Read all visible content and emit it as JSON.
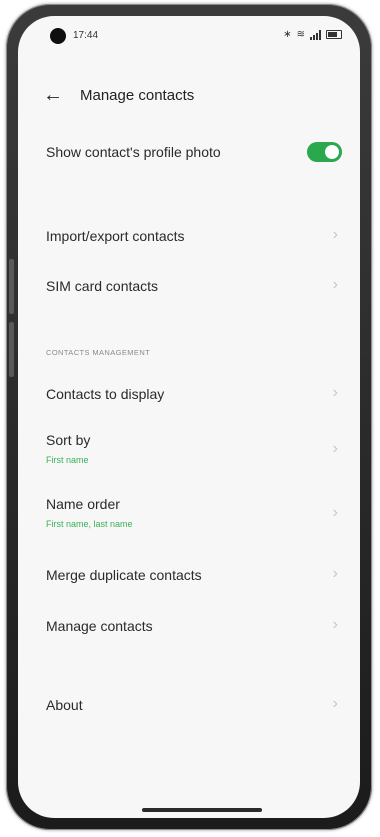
{
  "status_bar": {
    "time": "17:44",
    "icons": [
      "bluetooth-icon",
      "wifi-icon",
      "signal-icon",
      "battery-icon"
    ]
  },
  "header": {
    "back_icon": "arrow-left-icon",
    "title": "Manage contacts"
  },
  "settings": {
    "profile_photo": {
      "label": "Show contact's profile photo",
      "enabled": true
    },
    "import_export": {
      "label": "Import/export contacts"
    },
    "sim_contacts": {
      "label": "SIM card contacts"
    },
    "section_title": "CONTACTS MANAGEMENT",
    "contacts_to_display": {
      "label": "Contacts to display"
    },
    "sort_by": {
      "label": "Sort by",
      "value": "First name"
    },
    "name_order": {
      "label": "Name order",
      "value": "First name, last name"
    },
    "merge_duplicates": {
      "label": "Merge duplicate contacts"
    },
    "manage_contacts": {
      "label": "Manage contacts"
    },
    "about": {
      "label": "About"
    }
  },
  "colors": {
    "accent": "#2aa84d",
    "background": "#f7f7f7",
    "text": "#2a2a2a"
  }
}
